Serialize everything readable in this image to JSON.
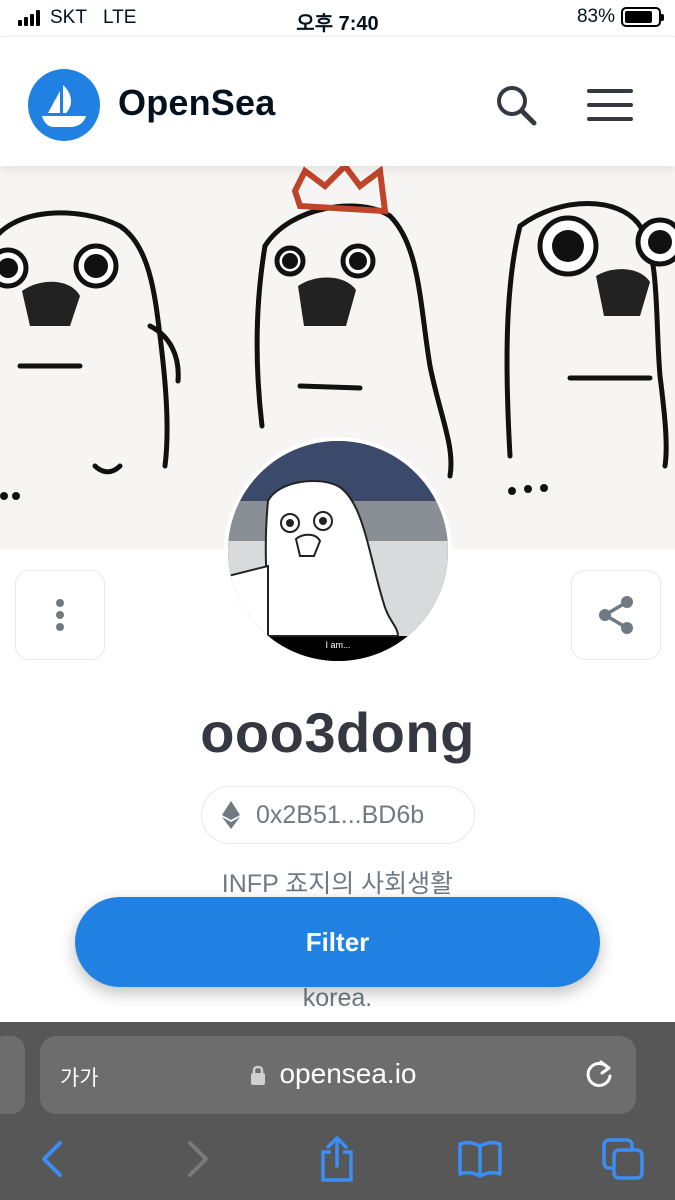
{
  "status": {
    "carrier": "SKT",
    "network": "LTE",
    "time": "오후 7:40",
    "battery": "83%",
    "battery_level": 0.83
  },
  "header": {
    "brand": "OpenSea",
    "logo_icon": "opensea-boat-icon",
    "search_icon": "search-icon",
    "menu_icon": "hamburger-menu-icon"
  },
  "profile": {
    "username": "ooo3dong",
    "address": "0x2B51...BD6b",
    "address_icon": "ethereum-icon",
    "bio_line1": "INFP 죠지의 사회생활",
    "bio_line2": "korea.",
    "avatar_caption": "I am...",
    "more_icon": "more-vertical-icon",
    "share_icon": "share-icon"
  },
  "filter_label": "Filter",
  "browser": {
    "text_size_label": "가가",
    "url": "opensea.io",
    "reload_icon": "reload-icon",
    "toolbar": [
      "back-icon",
      "forward-icon",
      "share-icon",
      "bookmarks-icon",
      "tabs-icon"
    ]
  },
  "colors": {
    "brand_blue": "#2081e2",
    "text_dark": "#353840",
    "text_muted": "#707a83",
    "safari_bar": "#575757"
  }
}
